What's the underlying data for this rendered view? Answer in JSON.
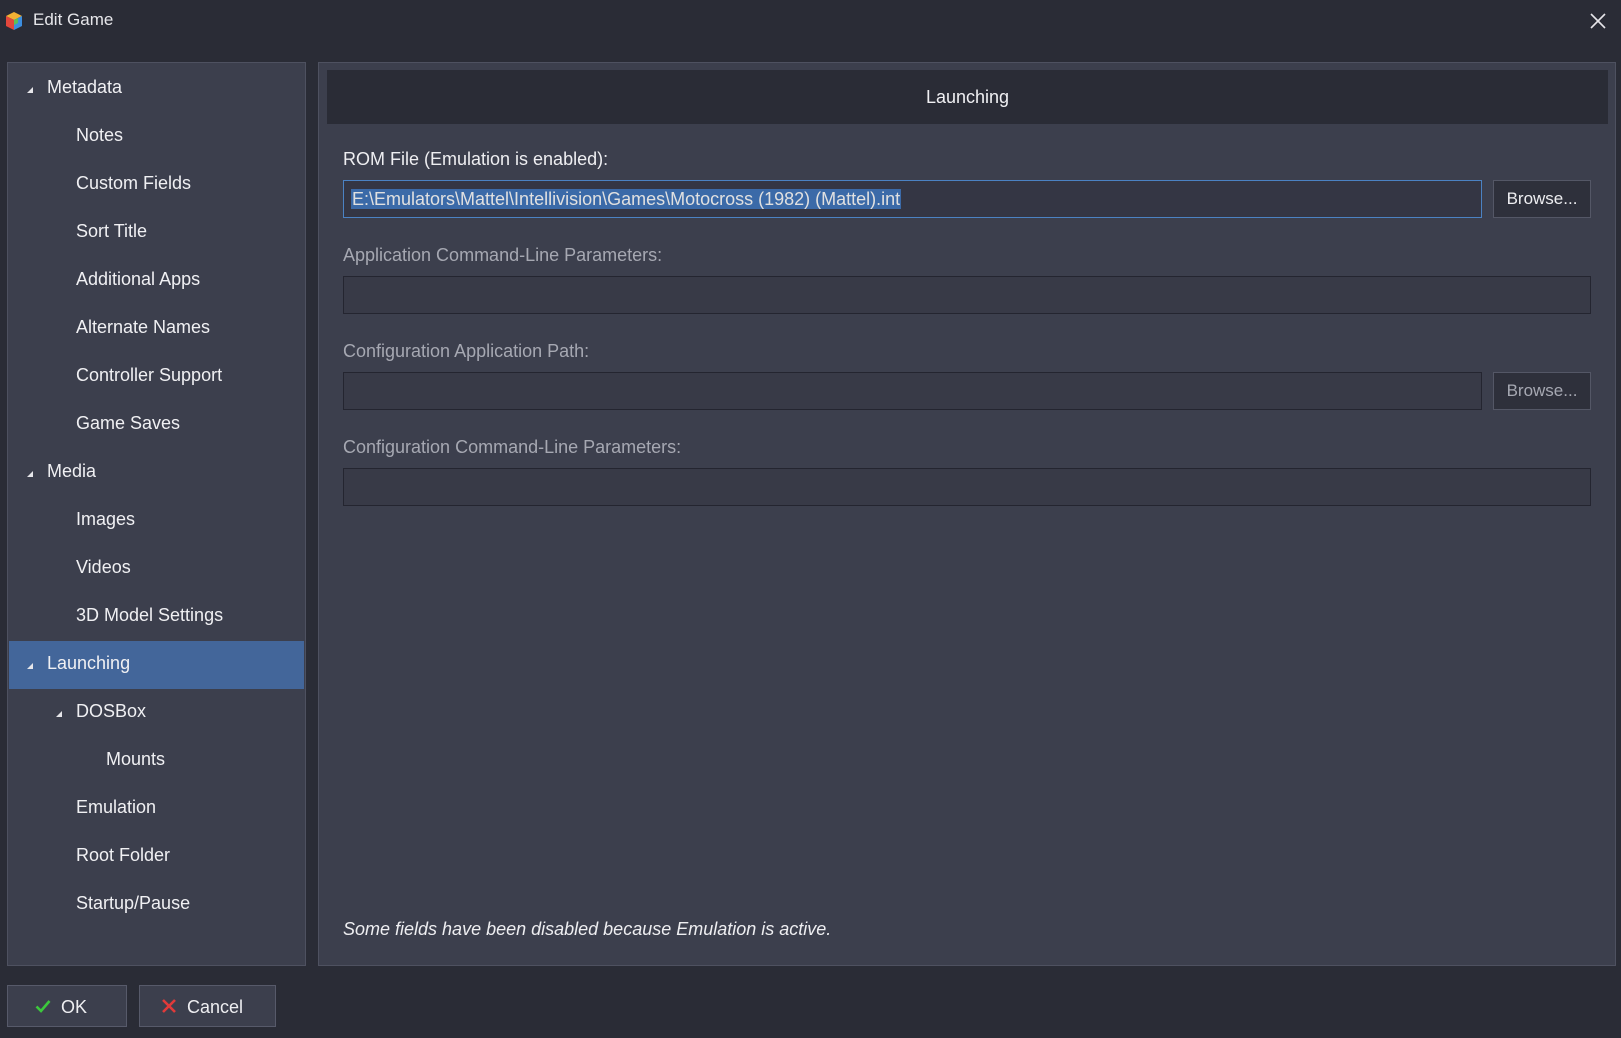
{
  "window": {
    "title": "Edit Game",
    "close_icon": "close-icon",
    "app_icon": "launchbox-cube-icon"
  },
  "sidebar": {
    "items": [
      {
        "label": "Metadata",
        "level": 0,
        "expanded": true,
        "selected": false
      },
      {
        "label": "Notes",
        "level": 1,
        "expanded": false,
        "selected": false
      },
      {
        "label": "Custom Fields",
        "level": 1,
        "expanded": false,
        "selected": false
      },
      {
        "label": "Sort Title",
        "level": 1,
        "expanded": false,
        "selected": false
      },
      {
        "label": "Additional Apps",
        "level": 1,
        "expanded": false,
        "selected": false
      },
      {
        "label": "Alternate Names",
        "level": 1,
        "expanded": false,
        "selected": false
      },
      {
        "label": "Controller Support",
        "level": 1,
        "expanded": false,
        "selected": false
      },
      {
        "label": "Game Saves",
        "level": 1,
        "expanded": false,
        "selected": false
      },
      {
        "label": "Media",
        "level": 0,
        "expanded": true,
        "selected": false
      },
      {
        "label": "Images",
        "level": 1,
        "expanded": false,
        "selected": false
      },
      {
        "label": "Videos",
        "level": 1,
        "expanded": false,
        "selected": false
      },
      {
        "label": "3D Model Settings",
        "level": 1,
        "expanded": false,
        "selected": false
      },
      {
        "label": "Launching",
        "level": 0,
        "expanded": true,
        "selected": true
      },
      {
        "label": "DOSBox",
        "level": 1,
        "expanded": true,
        "selected": false
      },
      {
        "label": "Mounts",
        "level": 2,
        "expanded": false,
        "selected": false
      },
      {
        "label": "Emulation",
        "level": 1,
        "expanded": false,
        "selected": false
      },
      {
        "label": "Root Folder",
        "level": 1,
        "expanded": false,
        "selected": false
      },
      {
        "label": "Startup/Pause",
        "level": 1,
        "expanded": false,
        "selected": false
      }
    ]
  },
  "main": {
    "header": "Launching",
    "rom_file": {
      "label": "ROM File (Emulation is enabled):",
      "value": "E:\\Emulators\\Mattel\\Intellivision\\Games\\Motocross (1982) (Mattel).int",
      "browse_label": "Browse..."
    },
    "app_params": {
      "label": "Application Command-Line Parameters:",
      "value": ""
    },
    "config_path": {
      "label": "Configuration Application Path:",
      "value": "",
      "browse_label": "Browse..."
    },
    "config_params": {
      "label": "Configuration Command-Line Parameters:",
      "value": ""
    },
    "note": "Some fields have been disabled because Emulation is active."
  },
  "footer": {
    "ok_label": "OK",
    "cancel_label": "Cancel"
  },
  "colors": {
    "background": "#2a2c36",
    "panel": "#3c3f4d",
    "selection": "#43669a",
    "focus_border": "#4b82c3",
    "ok_check": "#3cc83c",
    "cancel_x": "#e03a3a"
  }
}
